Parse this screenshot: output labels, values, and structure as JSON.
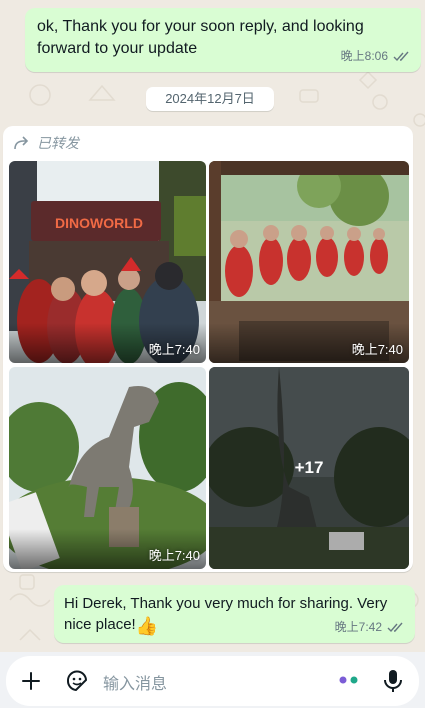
{
  "messages": {
    "outgoing_1": {
      "text": "ok, Thank you for your soon reply, and looking forward to your update",
      "time": "晚上8:06",
      "status": "read"
    },
    "date_separator": "2024年12月7日",
    "media": {
      "forwarded_label": "已转发",
      "tiles": [
        {
          "scene": "DinoWorld entrance with visitors",
          "sign_text": "DINOWORLD",
          "time": "晚上7:40"
        },
        {
          "scene": "Children group in red shirts",
          "time": "晚上7:40"
        },
        {
          "scene": "T-Rex dinosaur statue",
          "time": "晚上7:40"
        },
        {
          "scene": "Brachiosaurus silhouette",
          "more_count": "+17"
        }
      ]
    },
    "outgoing_2": {
      "text": "Hi Derek, Thank you very much for sharing. Very nice place!",
      "emoji": "👍",
      "time": "晚上7:42",
      "status": "read"
    }
  },
  "composer": {
    "placeholder": "输入消息",
    "icons": [
      "plus-icon",
      "sticker-icon",
      "meta-ai-icon",
      "microphone-icon"
    ]
  },
  "colors": {
    "chat_bg": "#efeae2",
    "outgoing_bubble": "#d9fdd3",
    "read_ticks": "#667781"
  }
}
